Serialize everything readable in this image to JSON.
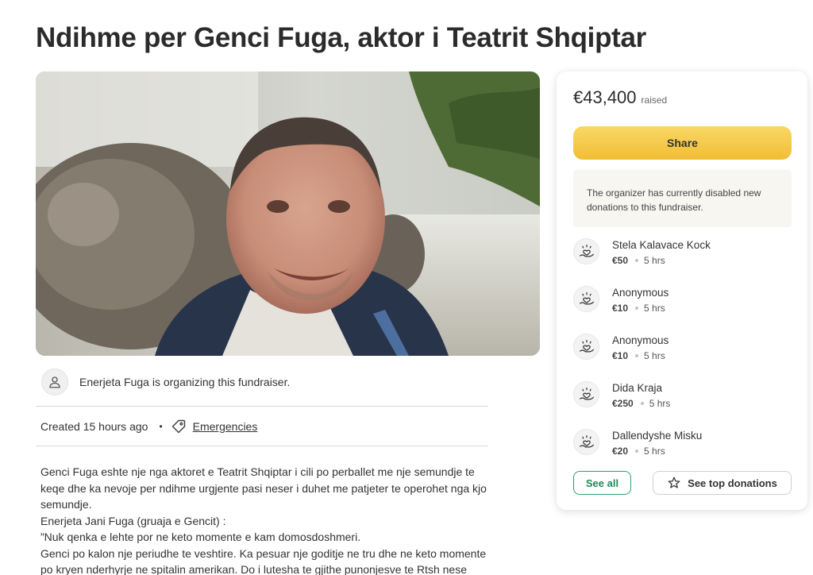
{
  "campaign": {
    "title": "Ndihme per Genci Fuga, aktor i Teatrit Shqiptar",
    "organizer_text": "Enerjeta Fuga is organizing this fundraiser.",
    "created": "Created 15 hours ago",
    "separator": "•",
    "category": "Emergencies",
    "story": [
      "Genci Fuga eshte nje nga aktoret e Teatrit Shqiptar i cili po perballet me nje semundje te keqe dhe ka nevoje per ndihme urgjente pasi neser i duhet me patjeter te operohet nga kjo semundje.",
      "Enerjeta Jani Fuga (gruaja e Gencit) :",
      "”Nuk qenka e lehte por ne keto momente e kam domosdoshmeri.",
      "Genci po kalon nje periudhe te veshtire. Ka pesuar nje goditje ne tru dhe ne keto momente po kryen nderhyrje ne spitalin amerikan. Do i lutesha te gjithe punonjesve te Rtsh nese"
    ]
  },
  "sidebar": {
    "raised_amount": "€43,400",
    "raised_label": "raised",
    "share_label": "Share",
    "notice": "The organizer has currently disabled new donations to this fundraiser.",
    "donations": [
      {
        "name": "Stela Kalavace Kock",
        "amount": "€50",
        "time": "5 hrs"
      },
      {
        "name": "Anonymous",
        "amount": "€10",
        "time": "5 hrs"
      },
      {
        "name": "Anonymous",
        "amount": "€10",
        "time": "5 hrs"
      },
      {
        "name": "Dida Kraja",
        "amount": "€250",
        "time": "5 hrs"
      },
      {
        "name": "Dallendyshe Misku",
        "amount": "€20",
        "time": "5 hrs"
      }
    ],
    "see_all_label": "See all",
    "see_top_label": "See top donations"
  },
  "icons": {
    "organizer": "user-outline-icon",
    "category": "tag-icon",
    "donation": "heart-hand-icon",
    "top": "star-outline-icon"
  },
  "colors": {
    "share_button": "#f2bd35",
    "see_all_border": "#2aa36b",
    "notice_bg": "#f8f6f1"
  }
}
